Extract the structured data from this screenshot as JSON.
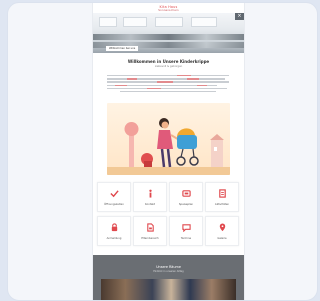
{
  "brand": {
    "line1": "Kita Haus",
    "line2": "Sonnenschein"
  },
  "hero": {
    "close_label": "×",
    "badge": "Willkommen bei uns"
  },
  "intro": {
    "title": "Willkommen in Unsere Kinderkrippe",
    "subtitle": "Liebevoll & geborgen"
  },
  "features": [
    {
      "label": "Öffnungszeiten",
      "icon": "check-icon"
    },
    {
      "label": "Kontakt",
      "icon": "info-icon"
    },
    {
      "label": "Speiseplan",
      "icon": "menu-icon"
    },
    {
      "label": "Aktivitäten",
      "icon": "document-icon"
    },
    {
      "label": "Anmeldung",
      "icon": "lock-icon"
    },
    {
      "label": "Elternbereich",
      "icon": "file-icon"
    },
    {
      "label": "Termine",
      "icon": "chat-icon"
    },
    {
      "label": "Galerie",
      "icon": "pin-icon"
    }
  ],
  "gallery": {
    "title": "Unsere Räume",
    "subtitle": "Einblick in unseren Alltag"
  },
  "colors": {
    "accent": "#e0484d",
    "dark_band": "#6a6e73"
  }
}
